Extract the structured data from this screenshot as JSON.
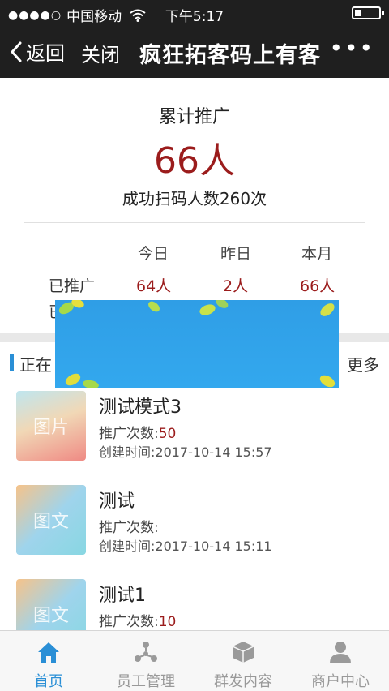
{
  "status": {
    "carrier": "中国移动",
    "time": "下午5:17"
  },
  "nav": {
    "back": "返回",
    "close": "关闭",
    "title": "疯狂拓客码上有客"
  },
  "summary": {
    "label": "累计推广",
    "total": "66人",
    "scan_text": "成功扫码人数260次"
  },
  "stats": {
    "headers": [
      "今日",
      "昨日",
      "本月"
    ],
    "rows": [
      {
        "label": "已推广",
        "values": [
          "64人",
          "2人",
          "66人"
        ]
      },
      {
        "label": "已",
        "values": []
      }
    ]
  },
  "section": {
    "title": "正在",
    "more": "更多"
  },
  "items": [
    {
      "thumb_text": "图片",
      "name": "测试模式3",
      "count_label": "推广次数:",
      "count": "50",
      "created": "创建时间:2017-10-14 15:57"
    },
    {
      "thumb_text": "图文",
      "name": "测试",
      "count_label": "推广次数:",
      "count": "",
      "created": "创建时间:2017-10-14 15:11"
    },
    {
      "thumb_text": "图文",
      "name": "测试1",
      "count_label": "推广次数:",
      "count": "10",
      "created": ""
    }
  ],
  "tabs": [
    {
      "label": "首页",
      "icon": "home-icon",
      "active": true
    },
    {
      "label": "员工管理",
      "icon": "network-icon",
      "active": false
    },
    {
      "label": "群发内容",
      "icon": "box-icon",
      "active": false
    },
    {
      "label": "商户中心",
      "icon": "user-icon",
      "active": false
    }
  ],
  "colors": {
    "accent": "#2a8fd6",
    "value_red": "#9b1c1c",
    "topbar": "#1f1f1f"
  }
}
